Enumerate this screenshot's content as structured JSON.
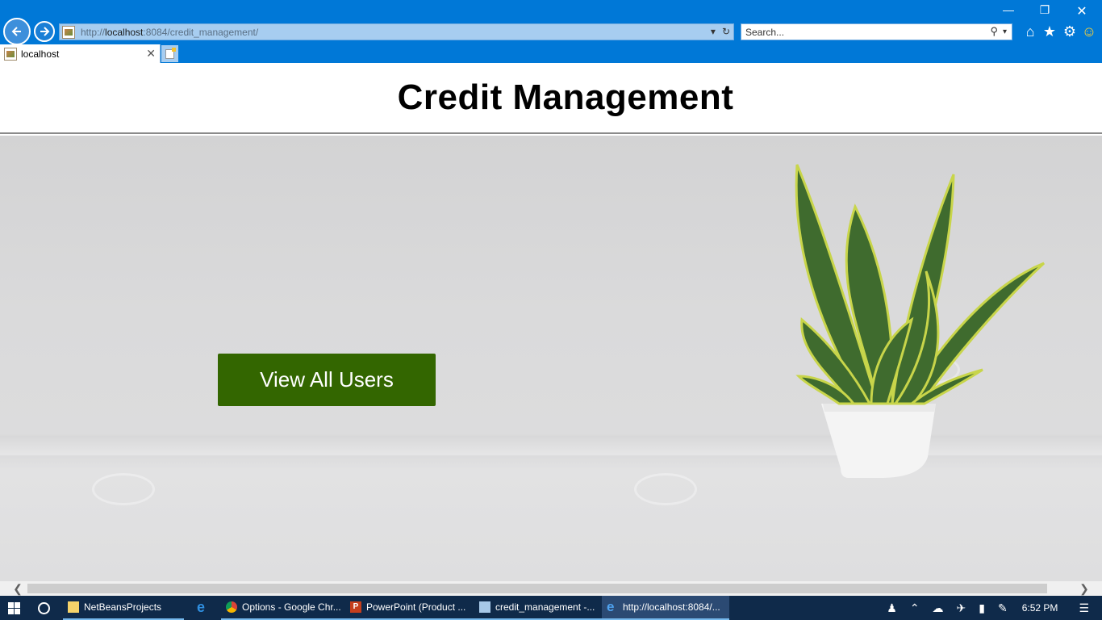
{
  "browser": {
    "address": {
      "scheme": "http://",
      "host": "localhost",
      "rest": ":8084/credit_management/"
    },
    "search_placeholder": "Search...",
    "tab_title": "localhost"
  },
  "page": {
    "title": "Credit Management",
    "button_label": "View All Users",
    "button_color": "#336600"
  },
  "taskbar": {
    "items": [
      {
        "label": "NetBeansProjects",
        "icon": "folder-icon"
      },
      {
        "label": "",
        "icon": "edge-icon"
      },
      {
        "label": "Options - Google Chr...",
        "icon": "chrome-icon"
      },
      {
        "label": "PowerPoint (Product ...",
        "icon": "powerpoint-icon"
      },
      {
        "label": "credit_management -...",
        "icon": "netbeans-icon"
      },
      {
        "label": "http://localhost:8084/...",
        "icon": "ie-icon"
      }
    ],
    "clock": "6:52 PM"
  },
  "colors": {
    "chrome_blue": "#0078d7",
    "taskbar": "#0f2a4a"
  }
}
